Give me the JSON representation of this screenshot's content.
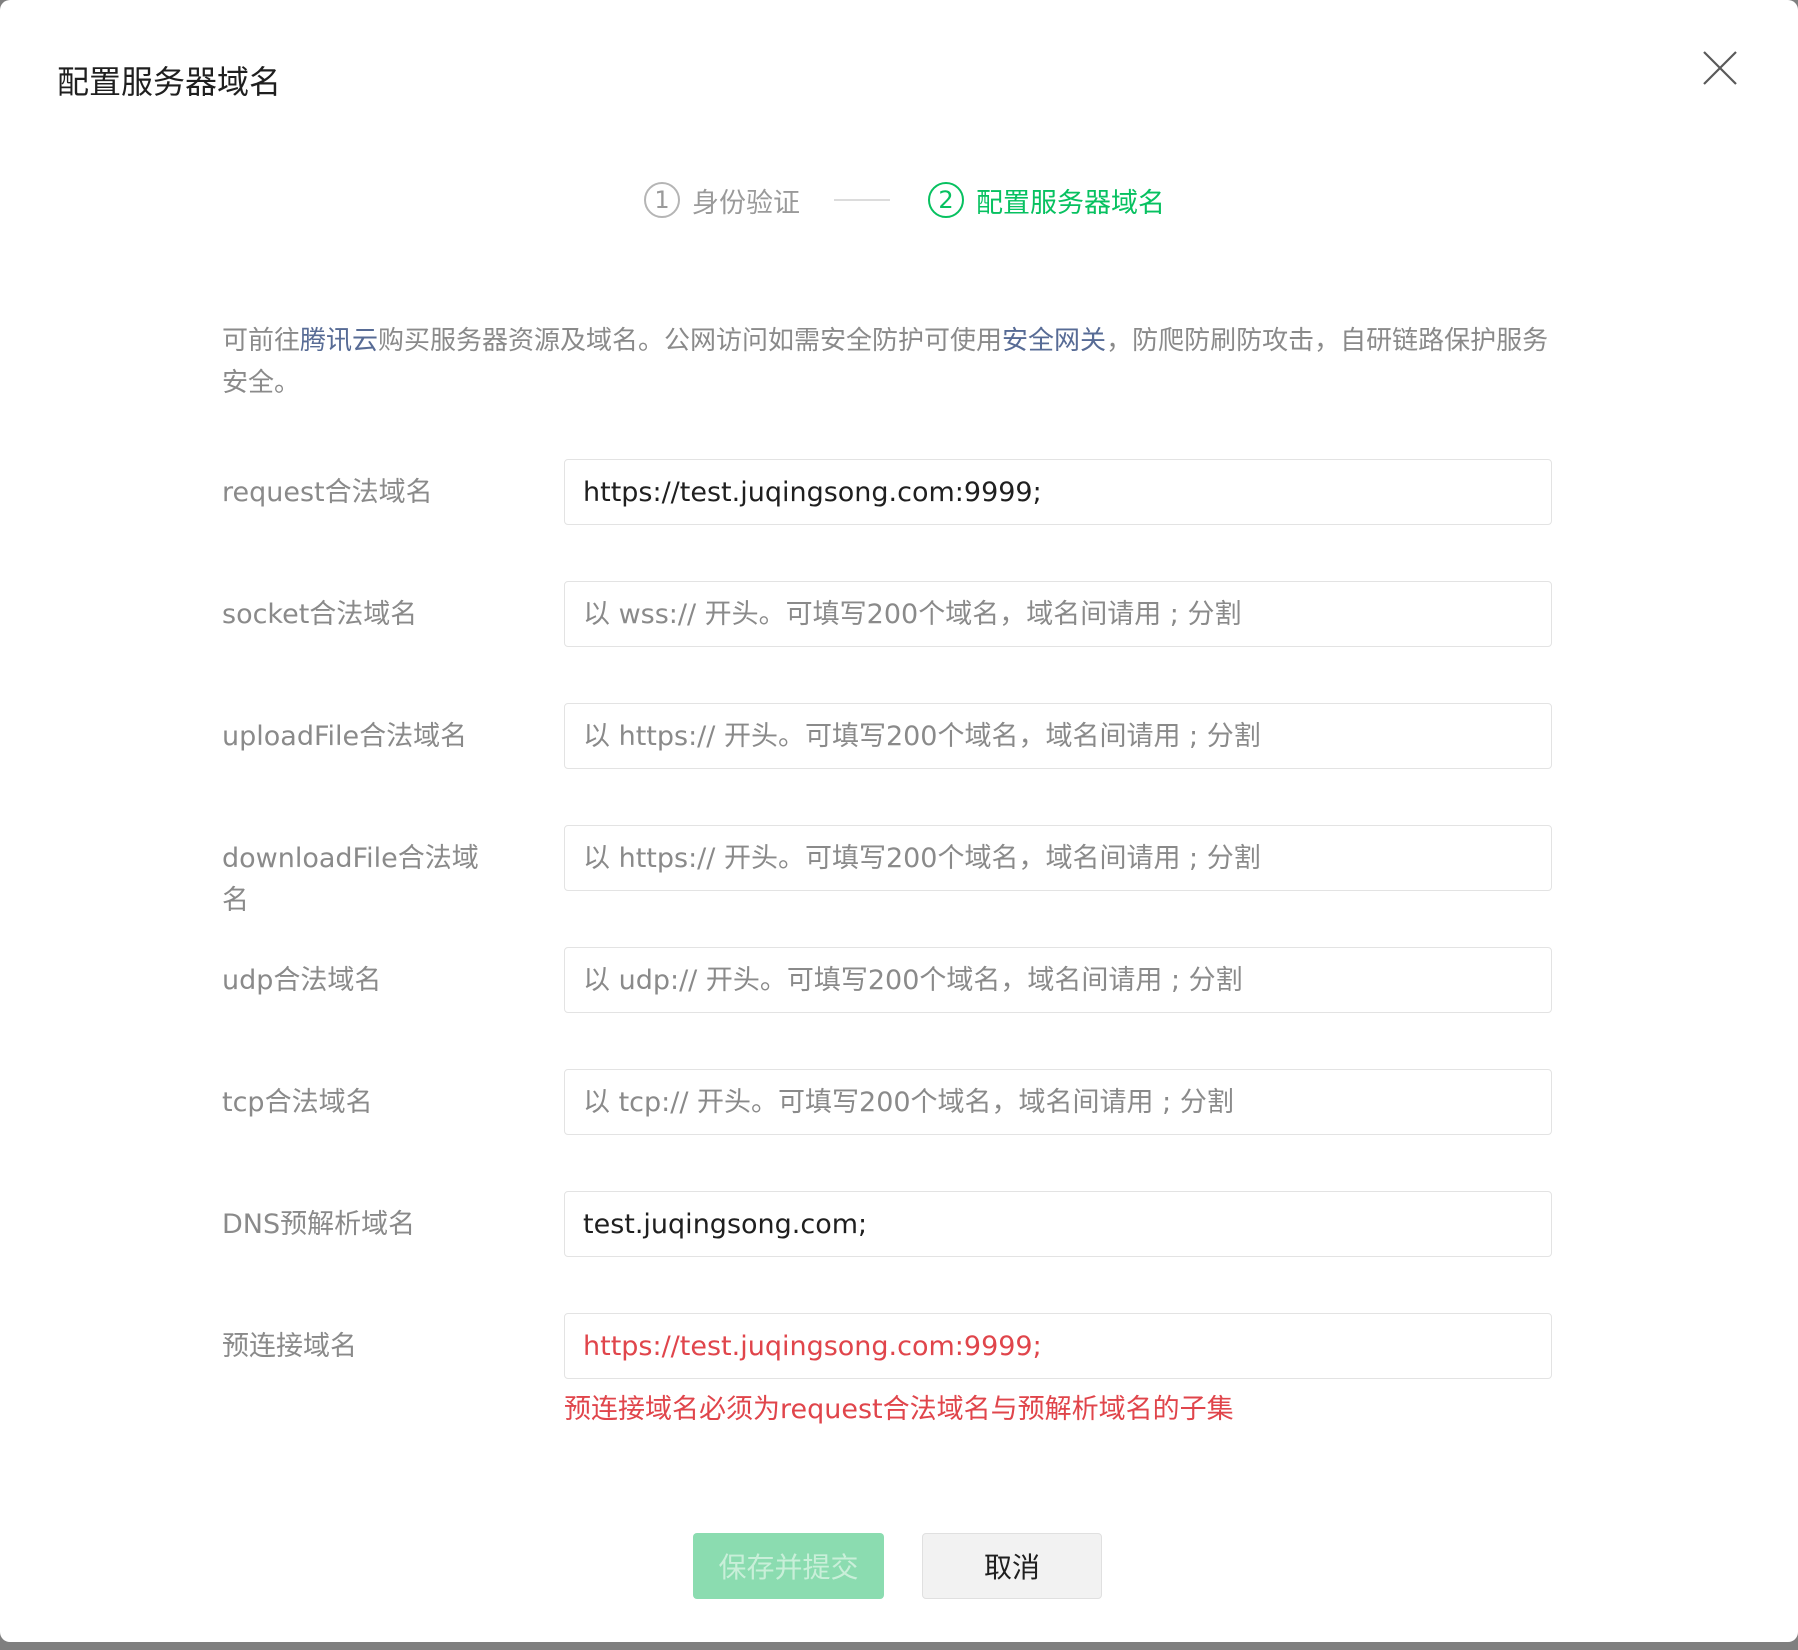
{
  "dialog": {
    "title": "配置服务器域名"
  },
  "steps": [
    {
      "num": "1",
      "label": "身份验证"
    },
    {
      "num": "2",
      "label": "配置服务器域名"
    }
  ],
  "description": {
    "part1": "可前往",
    "link1": "腾讯云",
    "part2": "购买服务器资源及域名。公网访问如需安全防护可使用",
    "link2": "安全网关",
    "part3": "，防爬防刷防攻击，自研链路保护服务安全。"
  },
  "fields": [
    {
      "label": "request合法域名",
      "value": "https://test.juqingsong.com:9999;",
      "placeholder": ""
    },
    {
      "label": "socket合法域名",
      "value": "",
      "placeholder": "以 wss:// 开头。可填写200个域名，域名间请用 ; 分割"
    },
    {
      "label": "uploadFile合法域名",
      "value": "",
      "placeholder": "以 https:// 开头。可填写200个域名，域名间请用 ; 分割"
    },
    {
      "label": "downloadFile合法域名",
      "value": "",
      "placeholder": "以 https:// 开头。可填写200个域名，域名间请用 ; 分割"
    },
    {
      "label": "udp合法域名",
      "value": "",
      "placeholder": "以 udp:// 开头。可填写200个域名，域名间请用 ; 分割"
    },
    {
      "label": "tcp合法域名",
      "value": "",
      "placeholder": "以 tcp:// 开头。可填写200个域名，域名间请用 ; 分割"
    },
    {
      "label": "DNS预解析域名",
      "value": "test.juqingsong.com;",
      "placeholder": ""
    },
    {
      "label": "预连接域名",
      "value": "https://test.juqingsong.com:9999;",
      "placeholder": ""
    }
  ],
  "error_message": "预连接域名必须为request合法域名与预解析域名的子集",
  "buttons": {
    "submit": "保存并提交",
    "cancel": "取消"
  },
  "colors": {
    "accent": "#07c160",
    "link": "#576b95",
    "error": "#e0454b",
    "submit_disabled_bg": "#8bdcb0"
  },
  "icons": {
    "close": "close-icon"
  }
}
